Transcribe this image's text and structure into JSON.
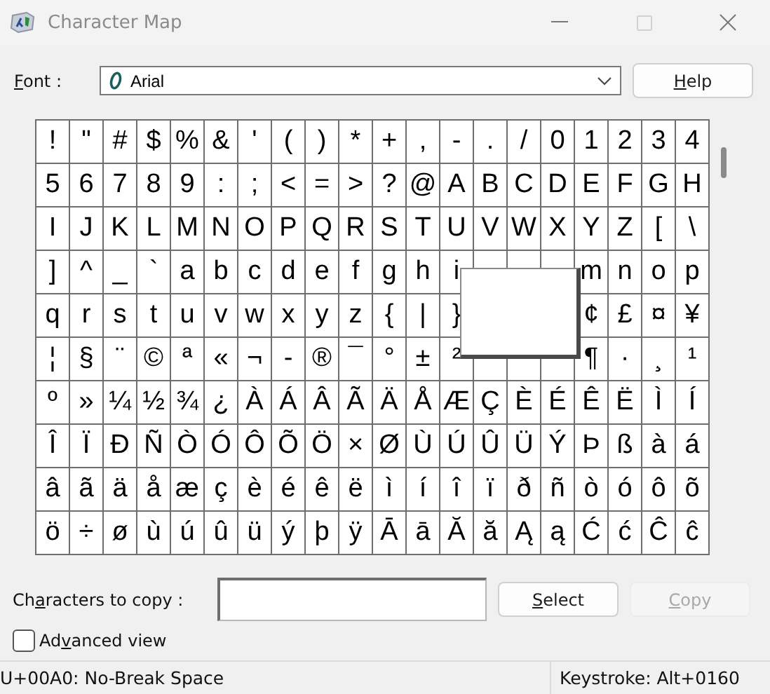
{
  "window": {
    "title": "Character Map",
    "buttons": [
      {
        "kind": "minimize",
        "disabled": false
      },
      {
        "kind": "maximize",
        "disabled": true
      },
      {
        "kind": "close",
        "disabled": false
      }
    ]
  },
  "font": {
    "label": {
      "key": "F",
      "post": "ont :"
    },
    "value": "Arial"
  },
  "help_button": {
    "label": {
      "key": "H",
      "post": "elp"
    }
  },
  "grid": {
    "rows": [
      [
        "!",
        "\"",
        "#",
        "$",
        "%",
        "&",
        "'",
        "(",
        ")",
        "*",
        "+",
        ",",
        "-",
        ".",
        "/",
        "0",
        "1",
        "2",
        "3",
        "4"
      ],
      [
        "5",
        "6",
        "7",
        "8",
        "9",
        ":",
        ";",
        "<",
        "=",
        ">",
        "?",
        "@",
        "A",
        "B",
        "C",
        "D",
        "E",
        "F",
        "G",
        "H"
      ],
      [
        "I",
        "J",
        "K",
        "L",
        "M",
        "N",
        "O",
        "P",
        "Q",
        "R",
        "S",
        "T",
        "U",
        "V",
        "W",
        "X",
        "Y",
        "Z",
        "[",
        "\\"
      ],
      [
        "]",
        "^",
        "_",
        "`",
        "a",
        "b",
        "c",
        "d",
        "e",
        "f",
        "g",
        "h",
        "i",
        null,
        null,
        null,
        "m",
        "n",
        "o",
        "p"
      ],
      [
        "q",
        "r",
        "s",
        "t",
        "u",
        "v",
        "w",
        "x",
        "y",
        "z",
        "{",
        "|",
        "}",
        null,
        null,
        null,
        "¢",
        "£",
        "¤",
        "¥"
      ],
      [
        "¦",
        "§",
        "¨",
        "©",
        "ª",
        "«",
        "¬",
        "-",
        "®",
        "¯",
        "°",
        "±",
        "²",
        null,
        null,
        null,
        "¶",
        "·",
        "¸",
        "¹"
      ],
      [
        "º",
        "»",
        "¼",
        "½",
        "¾",
        "¿",
        "À",
        "Á",
        "Â",
        "Ã",
        "Ä",
        "Å",
        "Æ",
        "Ç",
        "È",
        "É",
        "Ê",
        "Ë",
        "Ì",
        "Í"
      ],
      [
        "Î",
        "Ï",
        "Ð",
        "Ñ",
        "Ò",
        "Ó",
        "Ô",
        "Õ",
        "Ö",
        "×",
        "Ø",
        "Ù",
        "Ú",
        "Û",
        "Ü",
        "Ý",
        "Þ",
        "ß",
        "à",
        "á"
      ],
      [
        "â",
        "ã",
        "ä",
        "å",
        "æ",
        "ç",
        "è",
        "é",
        "ê",
        "ë",
        "ì",
        "í",
        "î",
        "ï",
        "ð",
        "ñ",
        "ò",
        "ó",
        "ô",
        "õ"
      ],
      [
        "ö",
        "÷",
        "ø",
        "ù",
        "ú",
        "û",
        "ü",
        "ý",
        "þ",
        "ÿ",
        "Ā",
        "ā",
        "Ă",
        "ă",
        "Ą",
        "ą",
        "Ć",
        "ć",
        "Ĉ",
        "ĉ"
      ]
    ]
  },
  "copy": {
    "label": {
      "pre": "Ch",
      "key": "a",
      "post": "racters to copy :"
    }
  },
  "buttons": [
    {
      "label": {
        "key": "S",
        "post": "elect"
      },
      "disabled": false
    },
    {
      "label": {
        "key": "C",
        "post": "opy"
      },
      "disabled": true
    }
  ],
  "advanced_view": {
    "label": {
      "pre": "Ad",
      "key": "v",
      "post": "anced view"
    },
    "checked": false
  },
  "status_bar": {
    "character": "U+00A0: No-Break Space",
    "keystroke": "Keystroke: Alt+0160"
  }
}
